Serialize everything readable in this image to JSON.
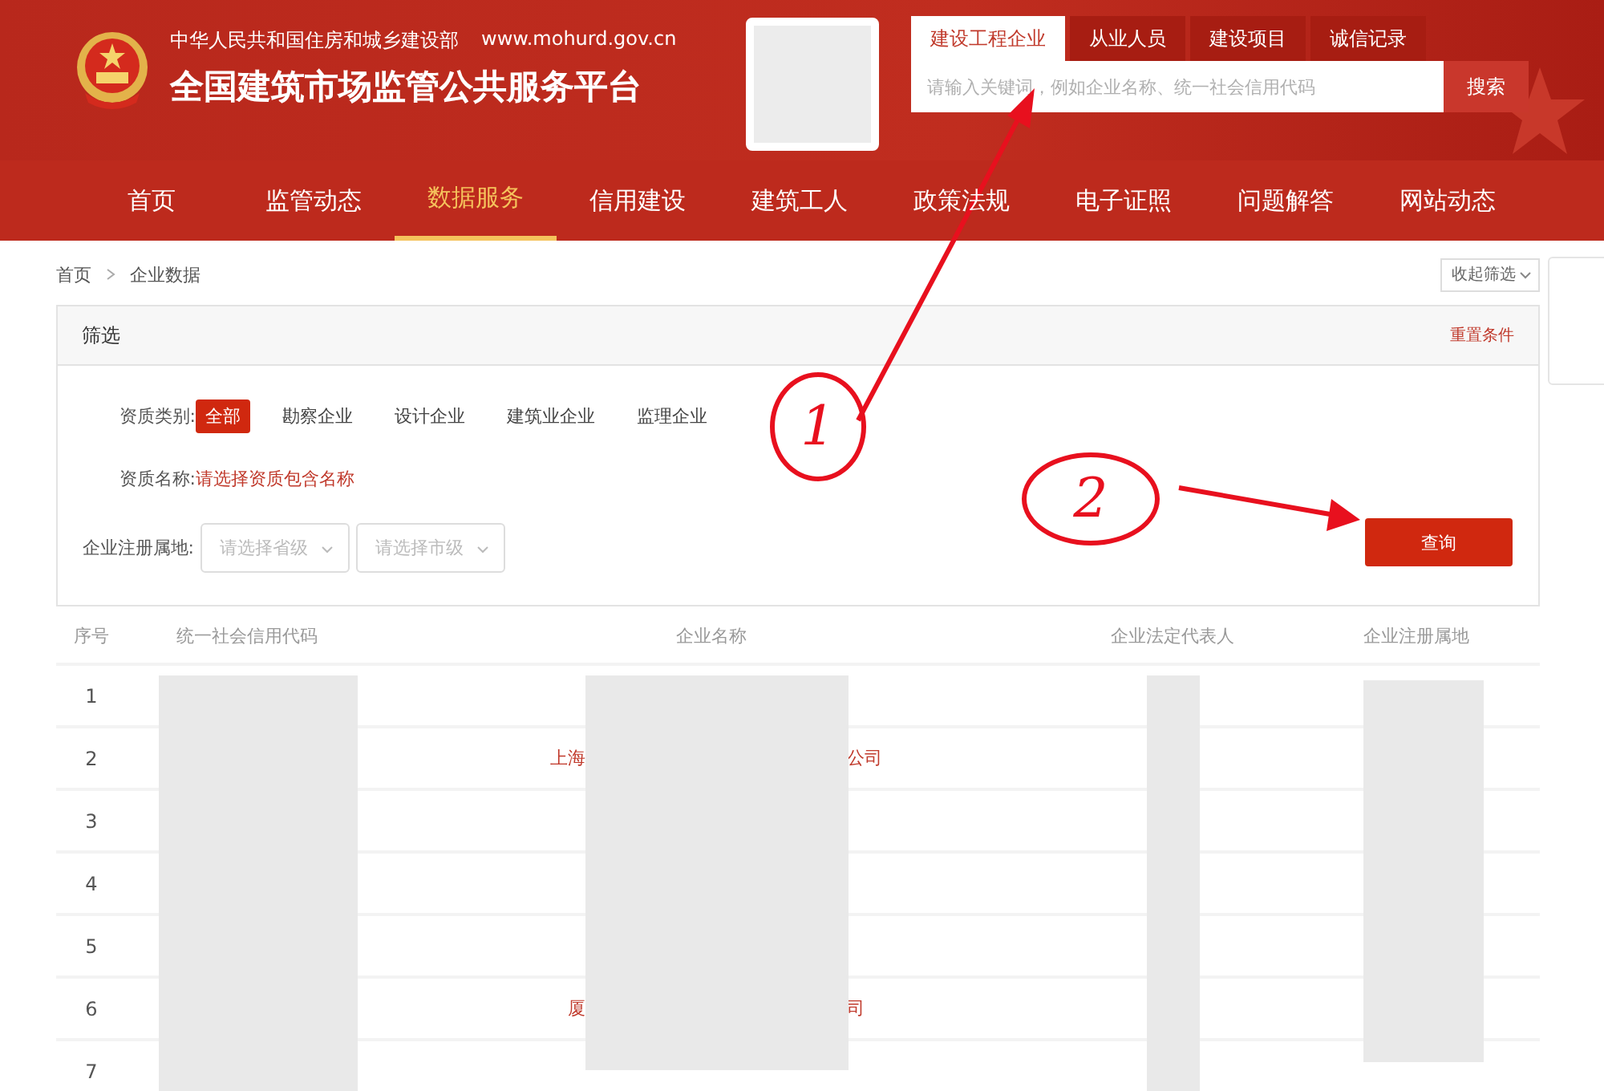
{
  "header": {
    "ministry": "中华人民共和国住房和城乡建设部",
    "website": "www.mohurd.gov.cn",
    "title": "全国建筑市场监管公共服务平台"
  },
  "search": {
    "tabs": [
      {
        "label": "建设工程企业",
        "selected": true
      },
      {
        "label": "从业人员",
        "selected": false
      },
      {
        "label": "建设项目",
        "selected": false
      },
      {
        "label": "诚信记录",
        "selected": false
      }
    ],
    "placeholder": "请输入关键词，例如企业名称、统一社会信用代码",
    "button": "搜索"
  },
  "nav": [
    {
      "label": "首页",
      "selected": false
    },
    {
      "label": "监管动态",
      "selected": false
    },
    {
      "label": "数据服务",
      "selected": true
    },
    {
      "label": "信用建设",
      "selected": false
    },
    {
      "label": "建筑工人",
      "selected": false
    },
    {
      "label": "政策法规",
      "selected": false
    },
    {
      "label": "电子证照",
      "selected": false
    },
    {
      "label": "问题解答",
      "selected": false
    },
    {
      "label": "网站动态",
      "selected": false
    }
  ],
  "breadcrumb": [
    "首页",
    "企业数据"
  ],
  "collapse_button": "收起筛选",
  "filter": {
    "title": "筛选",
    "reset": "重置条件",
    "category_label": "资质类别:",
    "categories": [
      {
        "label": "全部",
        "selected": true
      },
      {
        "label": "勘察企业",
        "selected": false
      },
      {
        "label": "设计企业",
        "selected": false
      },
      {
        "label": "建筑业企业",
        "selected": false
      },
      {
        "label": "监理企业",
        "selected": false
      }
    ],
    "name_label": "资质名称:",
    "name_link": "请选择资质包含名称",
    "region_label": "企业注册属地:",
    "province": {
      "placeholder": "请选择省级"
    },
    "city": {
      "placeholder": "请选择市级"
    },
    "query_button": "查询"
  },
  "table": {
    "columns": [
      "序号",
      "统一社会信用代码",
      "企业名称",
      "企业法定代表人",
      "企业注册属地"
    ],
    "rows": [
      {
        "index": "1"
      },
      {
        "index": "2",
        "name_start": "上海",
        "name_end": "公司"
      },
      {
        "index": "3"
      },
      {
        "index": "4"
      },
      {
        "index": "5"
      },
      {
        "index": "6",
        "name_start": "厦",
        "name_end": "司"
      },
      {
        "index": "7"
      }
    ]
  },
  "annotations": [
    {
      "label": "1"
    },
    {
      "label": "2"
    }
  ]
}
